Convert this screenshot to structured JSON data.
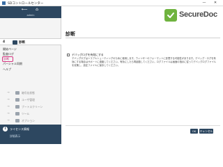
{
  "window": {
    "title": "SDコントロールセンター",
    "min_glyph": "—",
    "close_glyph": "✕"
  },
  "nav": {
    "back_glyph": "⟵",
    "home_glyph": "⌂",
    "user": "admin"
  },
  "section": {
    "number": "4",
    "label": "診断"
  },
  "sub_items": [
    "開始ページ",
    "監査ログ",
    "診断",
    "パーシャル同期",
    "ヘルプ"
  ],
  "selected_sub_item": "診断",
  "steps": [
    {
      "label": "暗号化状態"
    },
    {
      "label": "ユーザ管理"
    },
    {
      "label": "ブートスクリーン"
    },
    {
      "label": "ツール"
    },
    {
      "label": "オプション"
    }
  ],
  "license": {
    "icon": "i",
    "title": "ライセンス情報",
    "link": "詳細表示"
  },
  "brand": {
    "name": "SecureDoc",
    "color": "#6fb33f"
  },
  "page": {
    "title": "診断",
    "checkbox_label": "デバッグログを有効にする",
    "checkbox_checked": false,
    "description": "デバッグログはトラブルシューティングのために使用します。ウィンザーのフォーマットに影響する可能性があります。デバッグ・ログを有効にする場合はサポートに連絡してください。有効にしたら再起動してください。ログファイルは画面の指示に従ってデバッグログファイルを収集し、設定ファイルに保存してください。"
  },
  "buttons": {
    "ok": "OK",
    "cancel": "キャンセル"
  },
  "colors": {
    "nav_bg": "#2d4760",
    "accent_pink": "#d6337f"
  }
}
